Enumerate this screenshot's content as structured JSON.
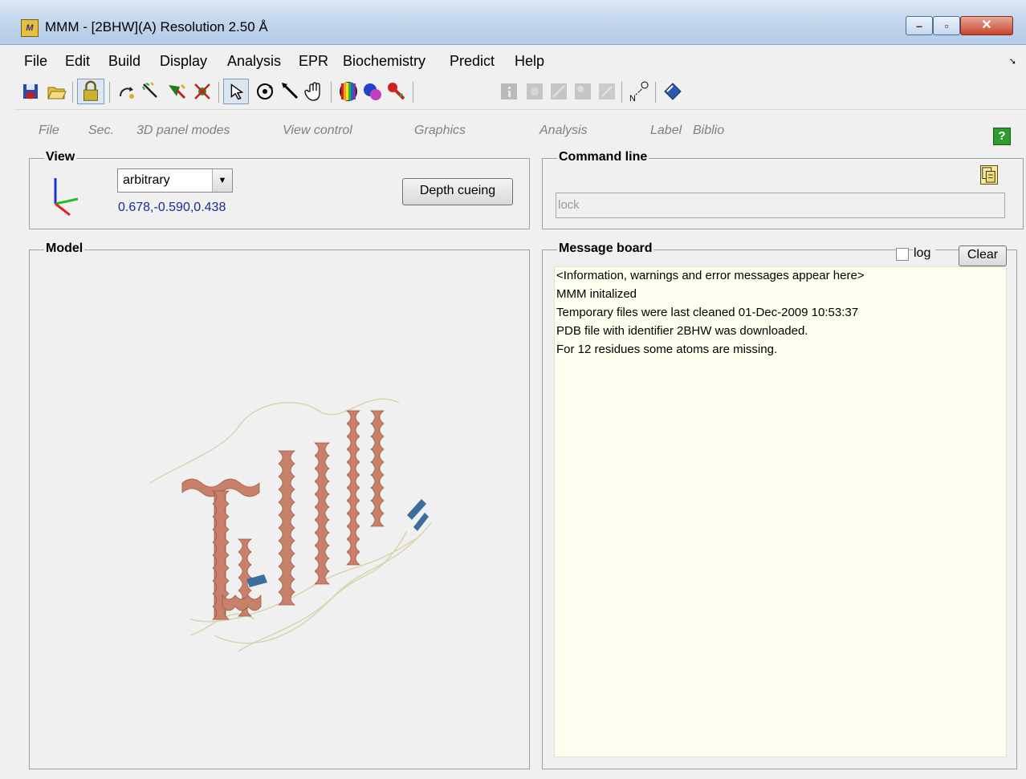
{
  "window": {
    "title": "MMM - [2BHW](A) Resolution 2.50 Å"
  },
  "menubar": {
    "items": [
      "File",
      "Edit",
      "Build",
      "Display",
      "Analysis",
      "EPR",
      "Biochemistry",
      "Predict",
      "Help"
    ]
  },
  "toolbar": {
    "icons": [
      "save-icon",
      "open-icon",
      "lock-icon",
      "rotate-icon",
      "rubberband-icon",
      "select-icon",
      "unselect-icon",
      "pointer-icon",
      "rotate-3d-icon",
      "move-icon",
      "hand-icon",
      "color-icon",
      "spheres-icon",
      "key-icon",
      "info-icon",
      "disabled-icon",
      "disabled-icon",
      "disabled-icon",
      "disabled-icon",
      "distance-icon",
      "book-icon"
    ]
  },
  "sections": [
    "File",
    "Sec.",
    "3D panel modes",
    "View control",
    "Graphics",
    "Analysis",
    "Label",
    "Biblio"
  ],
  "help": {
    "label": "?"
  },
  "view": {
    "title": "View",
    "selected": "arbitrary",
    "coords": "0.678,-0.590,0.438",
    "depth_label": "Depth cueing"
  },
  "command": {
    "title": "Command line",
    "value": "lock"
  },
  "model": {
    "title": "Model"
  },
  "messages": {
    "title": "Message board",
    "log_label": "log",
    "clear_label": "Clear",
    "lines": [
      "<Information, warnings and error messages appear here>",
      "MMM initalized",
      "Temporary files were last cleaned 01-Dec-2009 10:53:37",
      "PDB file with identifier 2BHW was downloaded.",
      "For 12 residues some atoms are missing."
    ]
  },
  "colors": {
    "helix": "#c8806a",
    "strand": "#3a6e9e",
    "coil": "#e8e4c8",
    "message_bg": "#fffff0"
  }
}
